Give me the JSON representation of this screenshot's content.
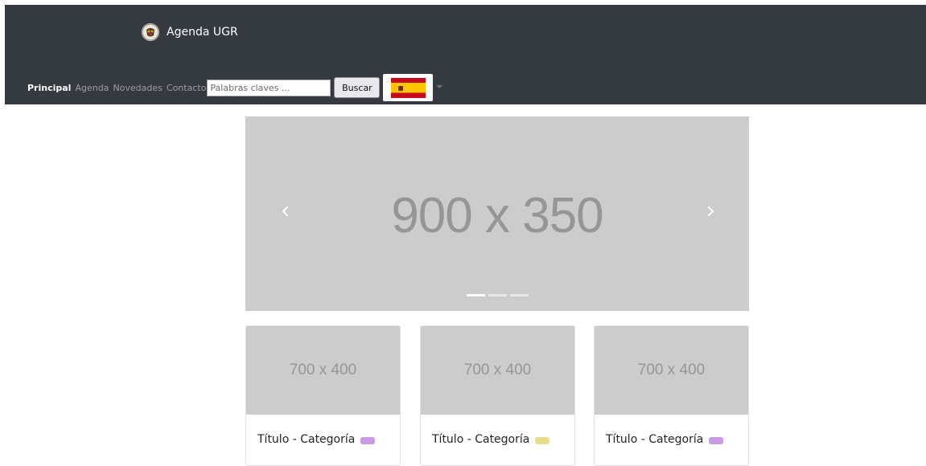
{
  "navbar": {
    "brand_name": "Agenda UGR",
    "brand_logo_icon": "university-crest-icon",
    "links": [
      {
        "label": "Principal",
        "active": true
      },
      {
        "label": "Agenda",
        "active": false
      },
      {
        "label": "Novedades",
        "active": false
      },
      {
        "label": "Contacto",
        "active": false
      }
    ],
    "search": {
      "value": "",
      "placeholder": "Palabras claves ..."
    },
    "search_button_label": "Buscar",
    "language": {
      "icon": "spain-flag-icon",
      "dropdown_icon": "caret-down-icon"
    },
    "colors": {
      "background": "#343a40"
    }
  },
  "carousel": {
    "placeholder_text": "900 x 350",
    "prev_icon": "chevron-left-icon",
    "next_icon": "chevron-right-icon",
    "slides_count": 3,
    "active_index": 0
  },
  "cards": [
    {
      "image_text": "700 x 400",
      "title": "Título - Categoría",
      "badge_color": "#cc99e6"
    },
    {
      "image_text": "700 x 400",
      "title": "Título - Categoría",
      "badge_color": "#e6dd8f"
    },
    {
      "image_text": "700 x 400",
      "title": "Título - Categoría",
      "badge_color": "#cc99e6"
    }
  ]
}
